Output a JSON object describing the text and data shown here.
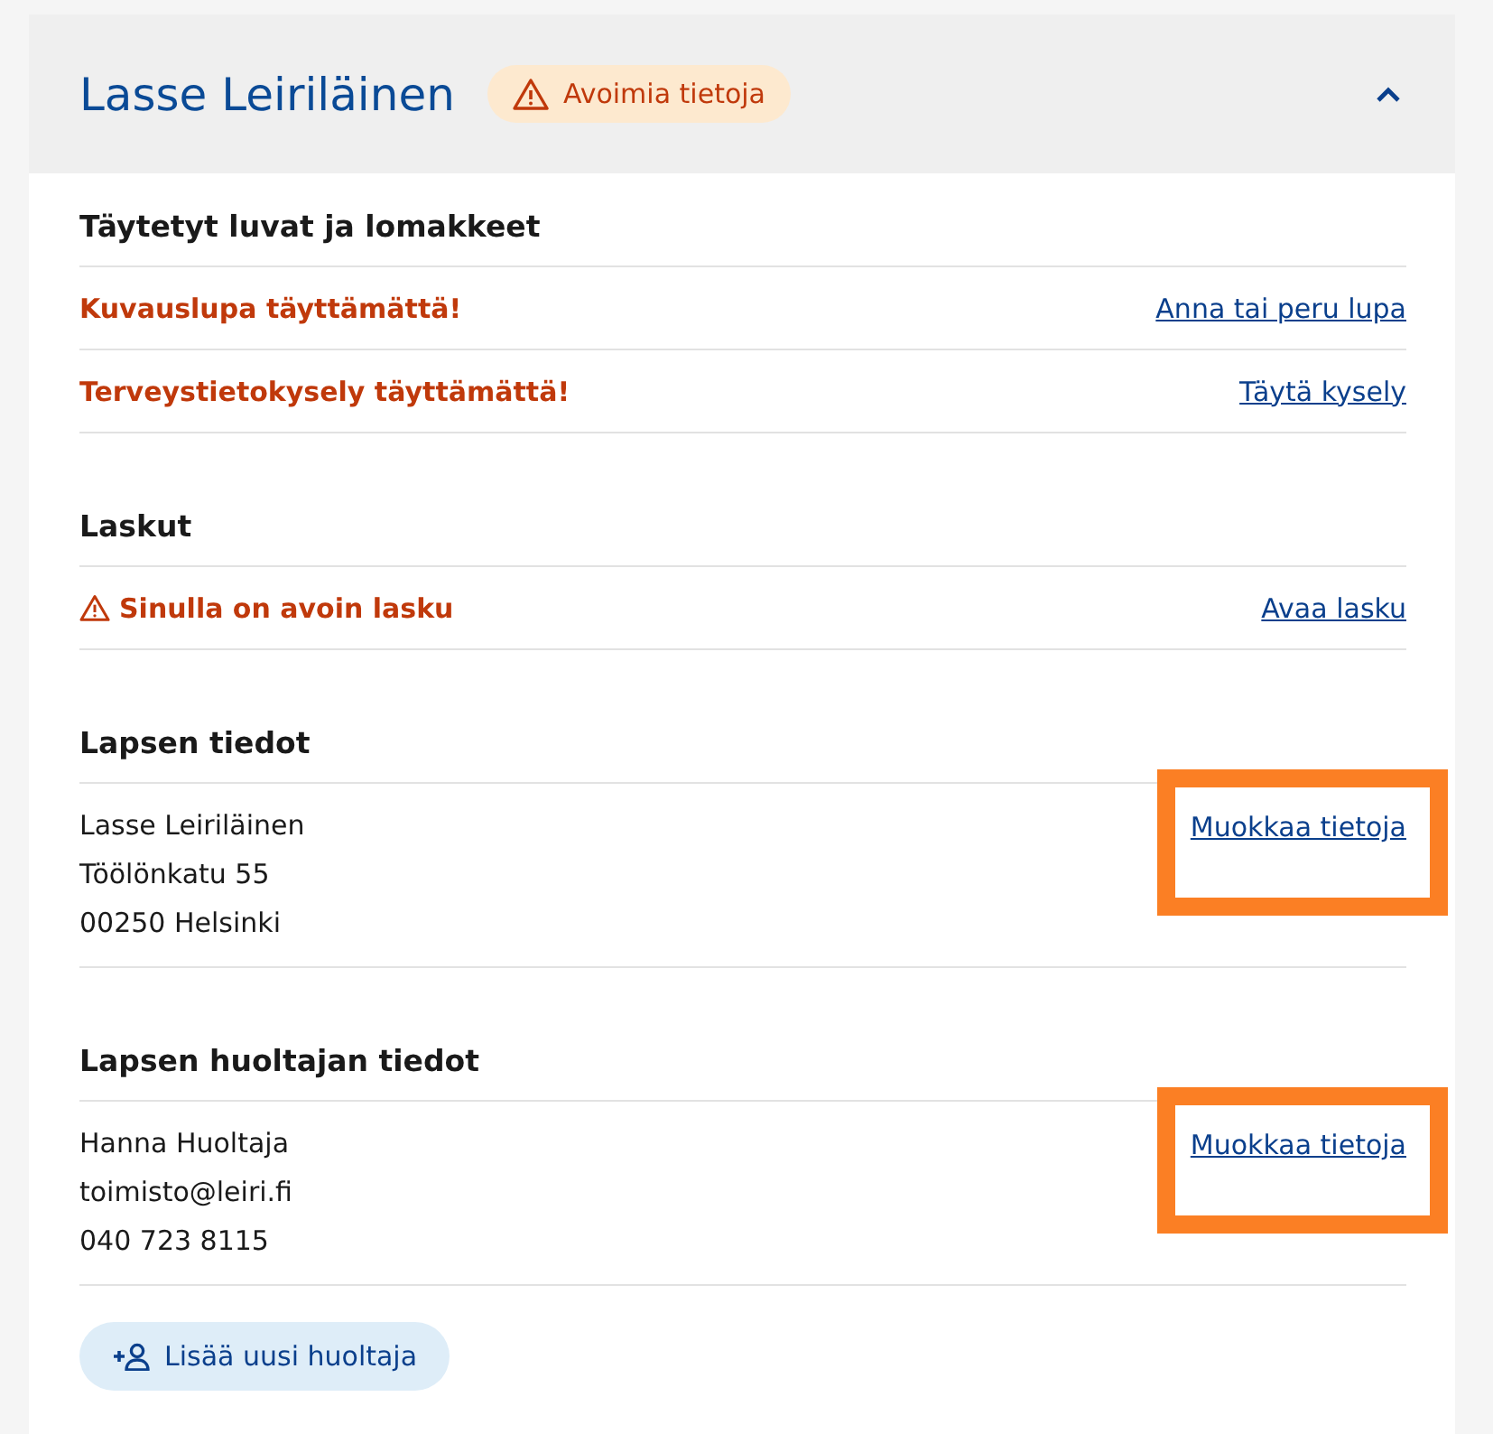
{
  "card": {
    "title": "Lasse Leiriläinen",
    "badge": "Avoimia tietoja",
    "expanded": true
  },
  "sections": [
    {
      "kind": "status",
      "title": "Täytetyt luvat ja lomakkeet",
      "rows": [
        {
          "text": "Kuvauslupa täyttämättä!",
          "link": "Anna tai peru lupa",
          "warning_icon": false
        },
        {
          "text": "Terveystietokysely täyttämättä!",
          "link": "Täytä kysely",
          "warning_icon": false
        }
      ]
    },
    {
      "kind": "status",
      "title": "Laskut",
      "rows": [
        {
          "text": "Sinulla on avoin lasku",
          "link": "Avaa lasku",
          "warning_icon": true
        }
      ]
    },
    {
      "kind": "details",
      "title": "Lapsen tiedot",
      "lines": [
        "Lasse Leiriläinen",
        "Töölönkatu 55",
        "00250 Helsinki"
      ],
      "link": "Muokkaa tietoja",
      "highlighted": true
    },
    {
      "kind": "details",
      "title": "Lapsen huoltajan tiedot",
      "lines": [
        "Hanna Huoltaja",
        "toimisto@leiri.fi",
        "040 723 8115"
      ],
      "link": "Muokkaa tietoja",
      "highlighted": true
    }
  ],
  "add_button": "Lisää uusi huoltaja"
}
